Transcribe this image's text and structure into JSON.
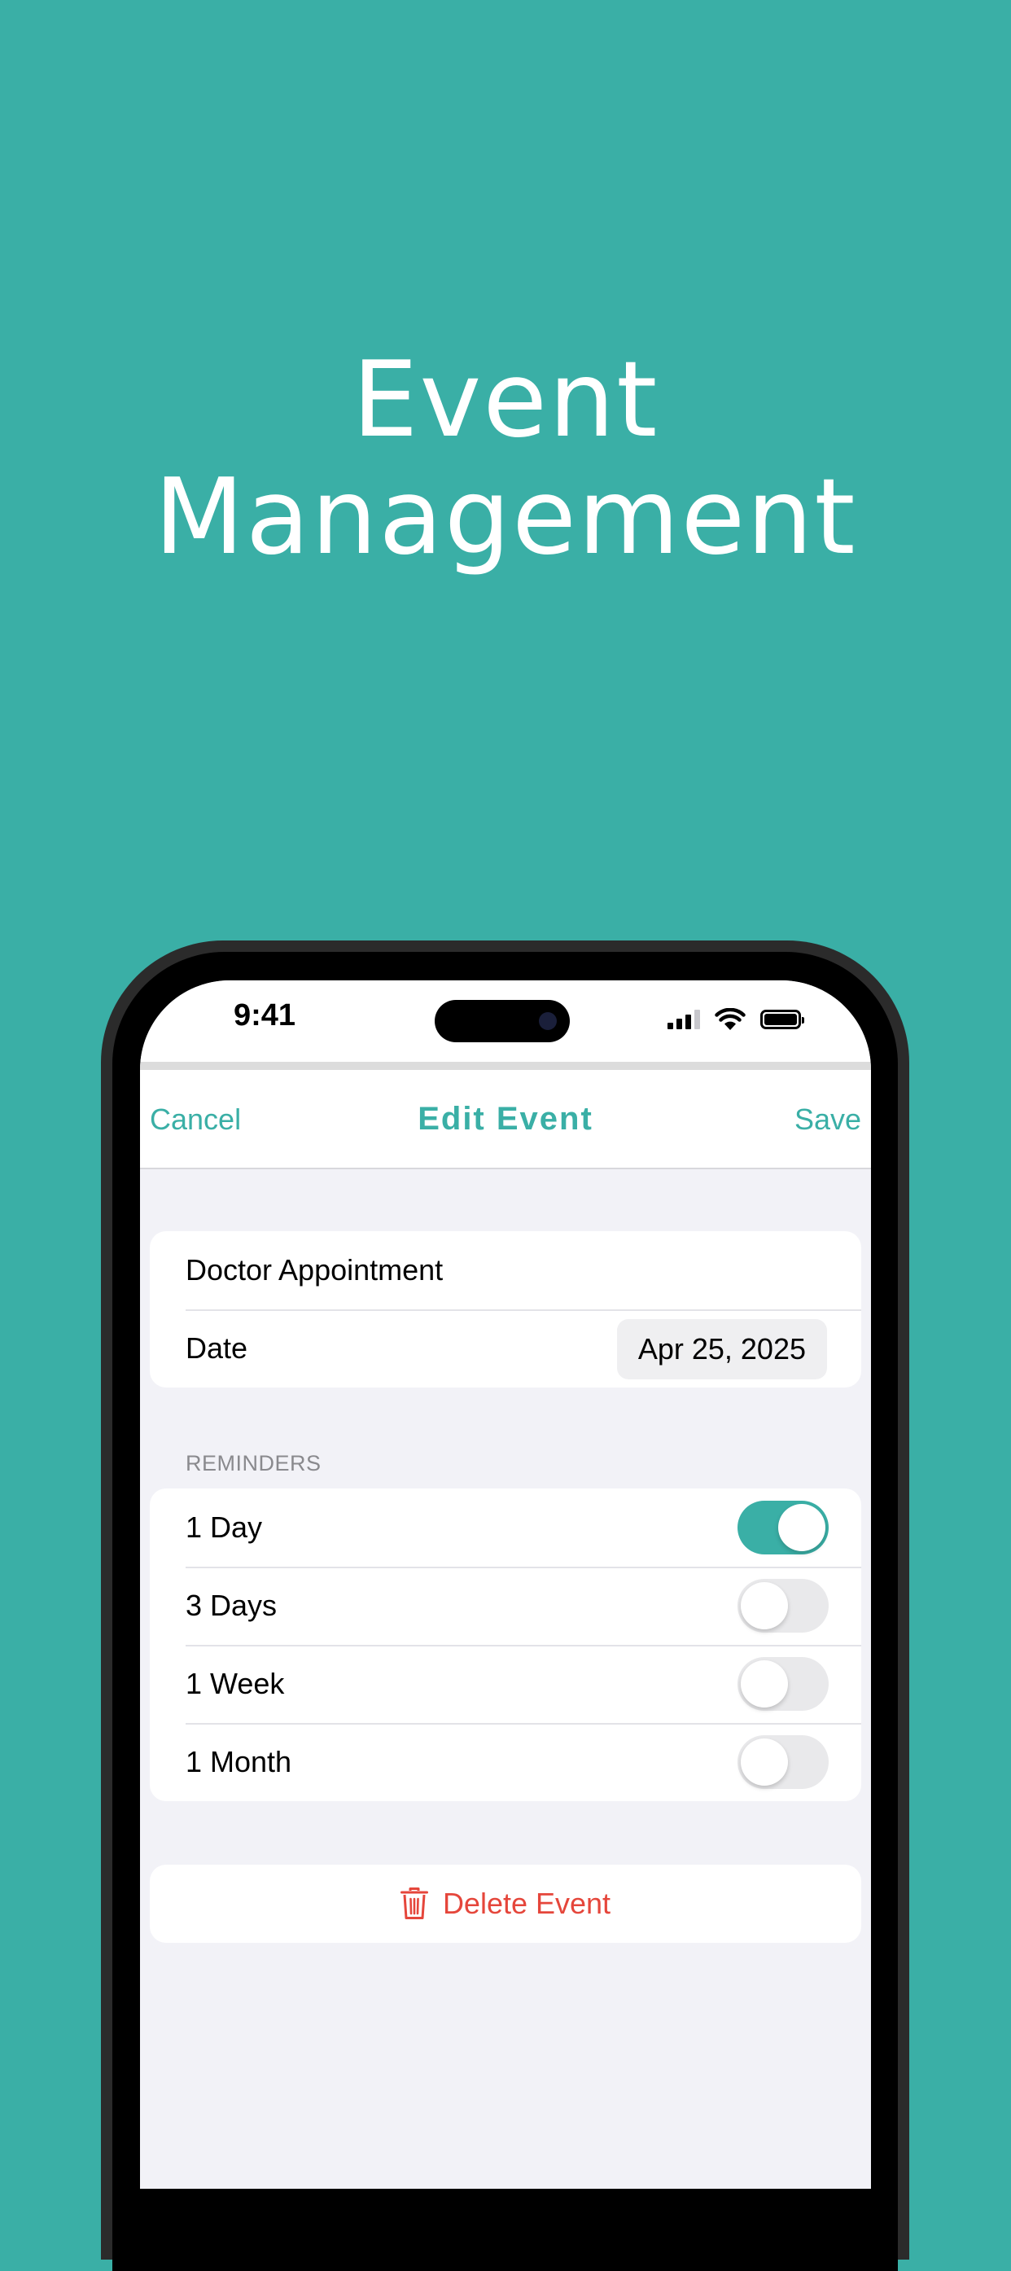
{
  "hero": {
    "line1": "Event",
    "line2": "Management"
  },
  "status_bar": {
    "time": "9:41"
  },
  "nav": {
    "cancel_label": "Cancel",
    "title": "Edit Event",
    "save_label": "Save"
  },
  "event": {
    "title": "Doctor Appointment",
    "date_label": "Date",
    "date_value": "Apr 25, 2025"
  },
  "reminders": {
    "header": "REMINDERS",
    "items": [
      {
        "label": "1 Day",
        "on": true
      },
      {
        "label": "3 Days",
        "on": false
      },
      {
        "label": "1 Week",
        "on": false
      },
      {
        "label": "1 Month",
        "on": false
      }
    ]
  },
  "delete": {
    "label": "Delete Event",
    "icon": "trash-icon"
  },
  "colors": {
    "accent": "#3AAFA6",
    "destructive": "#E5463B",
    "background": "#F2F2F7"
  }
}
